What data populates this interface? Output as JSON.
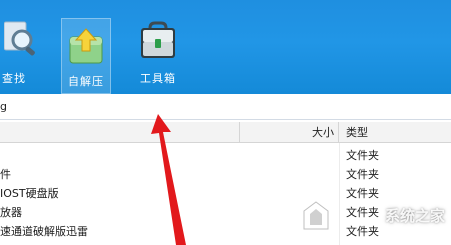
{
  "toolbar": {
    "search_label": "查找",
    "extract_label": "自解压",
    "tools_label": "工具箱"
  },
  "address": {
    "value": "g"
  },
  "columns": {
    "name": "",
    "size": "大小",
    "type": "类型"
  },
  "files": [
    {
      "name": "",
      "type": "文件夹"
    },
    {
      "name": "件",
      "type": "文件夹"
    },
    {
      "name": "IOST硬盘版",
      "type": "文件夹"
    },
    {
      "name": "放器",
      "type": "文件夹"
    },
    {
      "name": "速通道破解版迅雷",
      "type": "文件夹"
    }
  ],
  "arrow": {
    "color": "#e2191c"
  },
  "watermark": {
    "text": "系统之家"
  }
}
